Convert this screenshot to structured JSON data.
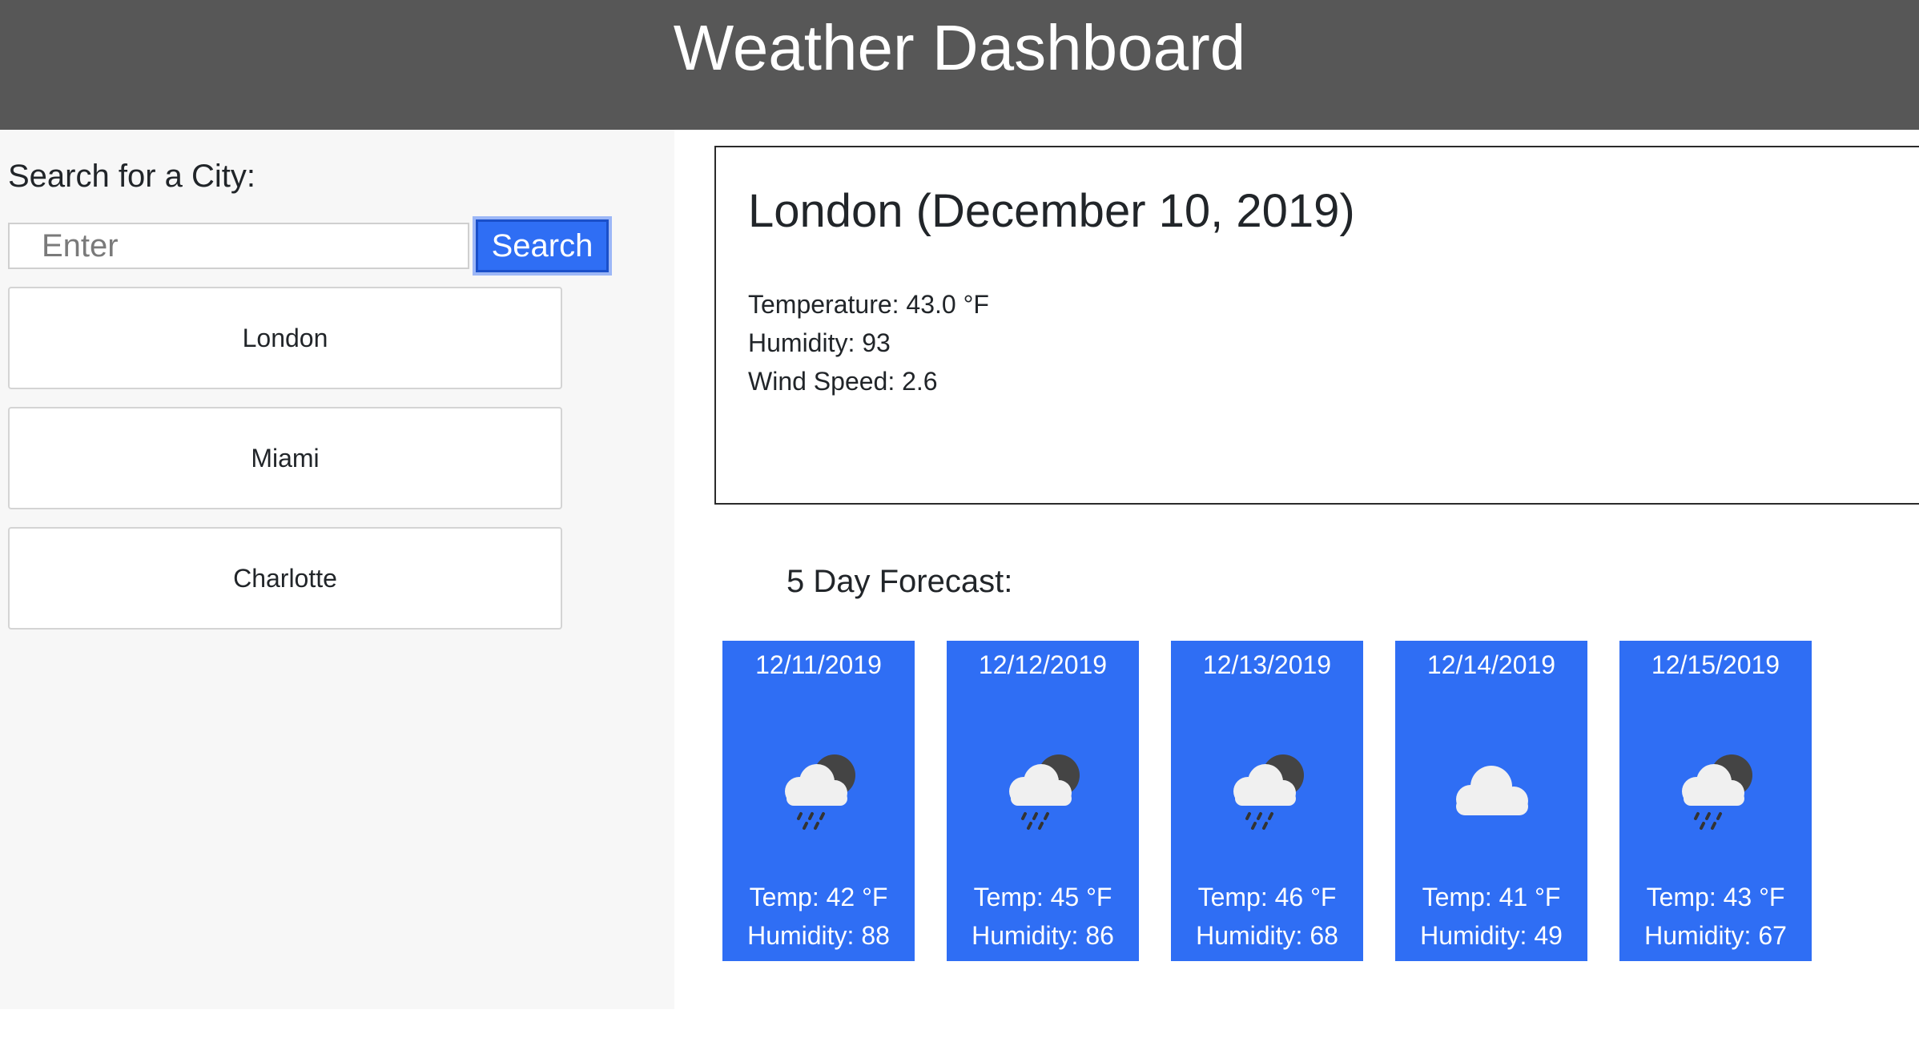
{
  "header": {
    "title": "Weather Dashboard"
  },
  "sidebar": {
    "title": "Search for a City:",
    "search": {
      "placeholder": "Enter",
      "value": "",
      "button_label": "Search"
    },
    "cities": [
      "London",
      "Miami",
      "Charlotte"
    ]
  },
  "current": {
    "title": "London (December 10, 2019)",
    "temperature": "Temperature: 43.0 °F",
    "humidity": "Humidity: 93",
    "wind": "Wind Speed: 2.6"
  },
  "forecast": {
    "title": "5 Day Forecast:",
    "days": [
      {
        "date": "12/11/2019",
        "icon": "rain-cloud-moon-icon",
        "temp": "Temp: 42 °F",
        "humidity": "Humidity: 88"
      },
      {
        "date": "12/12/2019",
        "icon": "rain-cloud-moon-icon",
        "temp": "Temp: 45 °F",
        "humidity": "Humidity: 86"
      },
      {
        "date": "12/13/2019",
        "icon": "rain-cloud-moon-icon",
        "temp": "Temp: 46 °F",
        "humidity": "Humidity: 68"
      },
      {
        "date": "12/14/2019",
        "icon": "cloud-icon",
        "temp": "Temp: 41 °F",
        "humidity": "Humidity: 49"
      },
      {
        "date": "12/15/2019",
        "icon": "rain-cloud-moon-icon",
        "temp": "Temp: 43 °F",
        "humidity": "Humidity: 67"
      }
    ]
  },
  "colors": {
    "header_bg": "#575757",
    "card_bg": "#2f6ef4",
    "button_bg": "#2f6ef4",
    "sidebar_bg": "#f7f7f7"
  }
}
